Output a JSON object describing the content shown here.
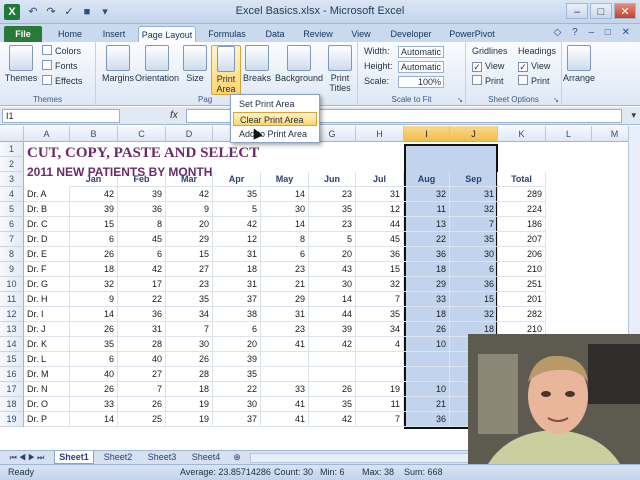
{
  "window": {
    "title": "Excel Basics.xlsx - Microsoft Excel"
  },
  "tabs": [
    "File",
    "Home",
    "Insert",
    "Page Layout",
    "Formulas",
    "Data",
    "Review",
    "View",
    "Developer",
    "PowerPivot"
  ],
  "ribbon": {
    "themes": {
      "themes_label": "Themes",
      "colors": "Colors",
      "fonts": "Fonts",
      "effects": "Effects",
      "group": "Themes"
    },
    "page_setup": {
      "margins": "Margins",
      "orientation": "Orientation",
      "size": "Size",
      "print_area": "Print Area",
      "breaks": "Breaks",
      "background": "Background",
      "print_titles": "Print Titles",
      "group": "Pag"
    },
    "scale": {
      "width_label": "Width:",
      "width_value": "Automatic",
      "height_label": "Height:",
      "height_value": "Automatic",
      "scale_label": "Scale:",
      "scale_value": "100%",
      "group": "Scale to Fit"
    },
    "sheet_options": {
      "gridlines": "Gridlines",
      "headings": "Headings",
      "view": "View",
      "print": "Print",
      "group": "Sheet Options"
    },
    "arrange": {
      "label": "Arrange"
    }
  },
  "print_area_menu": {
    "items": [
      "Set Print Area",
      "Clear Print Area",
      "Add to Print Area"
    ],
    "hover_index": 1
  },
  "formula_bar": {
    "name_box": "I1",
    "fx": "fx"
  },
  "sheet": {
    "col_headers": [
      "A",
      "B",
      "C",
      "D",
      "E",
      "F",
      "G",
      "H",
      "I",
      "J",
      "K",
      "L",
      "M"
    ],
    "row_numbers": [
      "1",
      "2",
      "3",
      "4",
      "5",
      "6",
      "7",
      "8",
      "9",
      "10",
      "11",
      "12",
      "13",
      "14",
      "15",
      "16",
      "17",
      "18",
      "19"
    ],
    "title": "CUT, COPY, PASTE AND SELECT",
    "subtitle": "2011 NEW PATIENTS BY MONTH",
    "month_headers": [
      "Jan",
      "Feb",
      "Mar",
      "Apr",
      "May",
      "Jun",
      "Jul",
      "Aug",
      "Sep"
    ],
    "total_header": "Total",
    "rows": [
      {
        "name": "Dr. A",
        "values": [
          "42",
          "39",
          "42",
          "35",
          "14",
          "23",
          "31",
          "32",
          "31"
        ],
        "total": "289"
      },
      {
        "name": "Dr. B",
        "values": [
          "39",
          "36",
          "9",
          "5",
          "30",
          "35",
          "12",
          "11",
          "32"
        ],
        "total": "224"
      },
      {
        "name": "Dr. C",
        "values": [
          "15",
          "8",
          "20",
          "42",
          "14",
          "23",
          "44",
          "13",
          "7"
        ],
        "total": "186"
      },
      {
        "name": "Dr. D",
        "values": [
          "6",
          "45",
          "29",
          "12",
          "8",
          "5",
          "45",
          "22",
          "35"
        ],
        "total": "207"
      },
      {
        "name": "Dr. E",
        "values": [
          "26",
          "6",
          "15",
          "31",
          "6",
          "20",
          "36",
          "36",
          "30"
        ],
        "total": "206"
      },
      {
        "name": "Dr. F",
        "values": [
          "18",
          "42",
          "27",
          "18",
          "23",
          "43",
          "15",
          "18",
          "6"
        ],
        "total": "210"
      },
      {
        "name": "Dr. G",
        "values": [
          "32",
          "17",
          "23",
          "31",
          "21",
          "30",
          "32",
          "29",
          "36"
        ],
        "total": "251"
      },
      {
        "name": "Dr. H",
        "values": [
          "9",
          "22",
          "35",
          "37",
          "29",
          "14",
          "7",
          "33",
          "15"
        ],
        "total": "201"
      },
      {
        "name": "Dr. I",
        "values": [
          "14",
          "36",
          "34",
          "38",
          "31",
          "44",
          "35",
          "18",
          "32"
        ],
        "total": "282"
      },
      {
        "name": "Dr. J",
        "values": [
          "26",
          "31",
          "7",
          "6",
          "23",
          "39",
          "34",
          "26",
          "18"
        ],
        "total": "210"
      },
      {
        "name": "Dr. K",
        "values": [
          "35",
          "28",
          "30",
          "20",
          "41",
          "42",
          "4",
          "10",
          ""
        ],
        "total": ""
      },
      {
        "name": "Dr. L",
        "values": [
          "6",
          "40",
          "26",
          "39",
          "",
          "",
          "",
          "",
          ""
        ],
        "total": ""
      },
      {
        "name": "Dr. M",
        "values": [
          "40",
          "27",
          "28",
          "35",
          "",
          "",
          "",
          "",
          ""
        ],
        "total": ""
      },
      {
        "name": "Dr. N",
        "values": [
          "26",
          "7",
          "18",
          "22",
          "33",
          "26",
          "19",
          "10",
          ""
        ],
        "total": ""
      },
      {
        "name": "Dr. O",
        "values": [
          "33",
          "26",
          "19",
          "30",
          "41",
          "35",
          "11",
          "21",
          ""
        ],
        "total": ""
      },
      {
        "name": "Dr. P",
        "values": [
          "14",
          "25",
          "19",
          "37",
          "41",
          "42",
          "7",
          "36",
          ""
        ],
        "total": ""
      }
    ]
  },
  "sheet_tabs": [
    "Sheet1",
    "Sheet2",
    "Sheet3",
    "Sheet4"
  ],
  "status": {
    "ready": "Ready",
    "average": "Average: 23.85714286",
    "count": "Count: 30",
    "min": "Min: 6",
    "max": "Max: 38",
    "sum": "Sum: 668"
  }
}
